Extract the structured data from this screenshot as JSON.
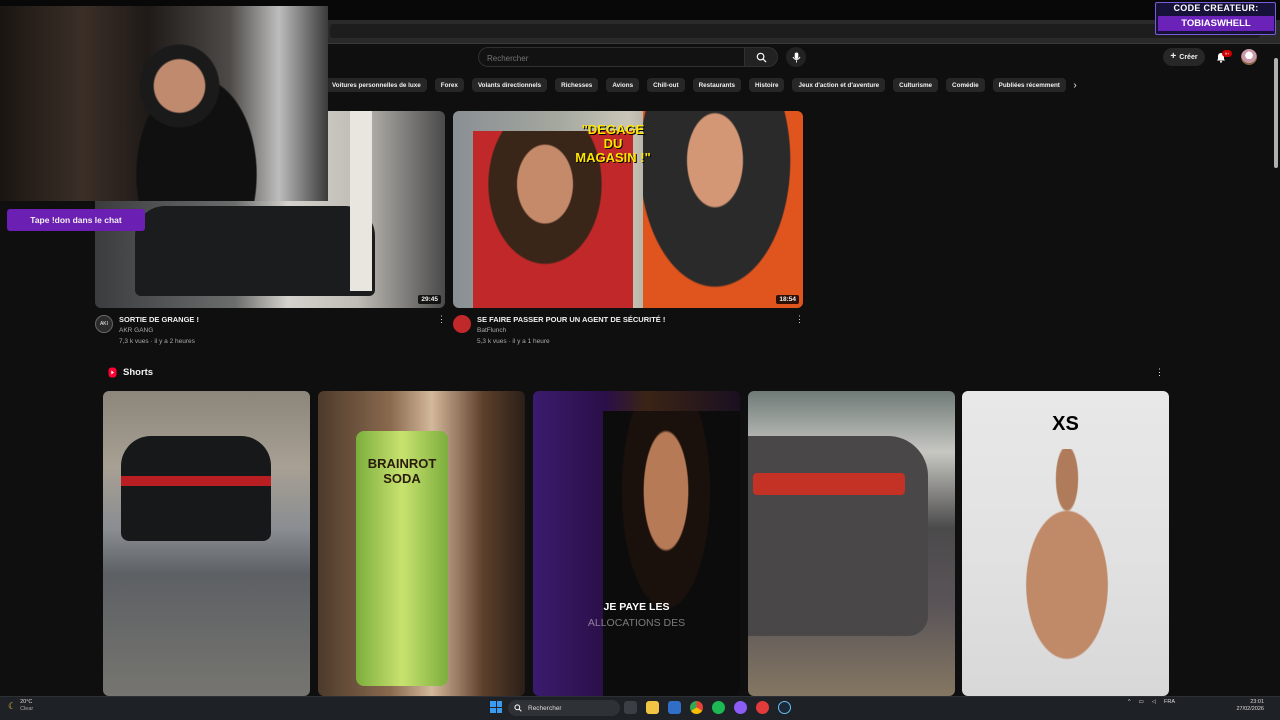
{
  "search": {
    "placeholder": "Rechercher"
  },
  "header": {
    "create_label": "Créer",
    "notif_badge": "9+"
  },
  "chips": [
    "Voitures personnelles de luxe",
    "Forex",
    "Volants directionnels",
    "Richesses",
    "Avions",
    "Chill-out",
    "Restaurants",
    "Histoire",
    "Jeux d'action et d'aventure",
    "Culturisme",
    "Comédie",
    "Publiées récemment"
  ],
  "videos": [
    {
      "title": "SORTIE DE GRANGE !",
      "channel": "AKR GANG",
      "meta": "7,3 k vues · il y a 2 heures",
      "duration": "29:45"
    },
    {
      "title": "SE FAIRE PASSER POUR UN AGENT DE SÉCURITÉ !",
      "channel": "BatFlunch",
      "meta": "5,3 k vues · il y a 1 heure",
      "duration": "18:54",
      "overlay": "\"DEGAGE DU MAGASIN !\""
    }
  ],
  "shorts": {
    "label": "Shorts",
    "items": [
      {
        "overlay": ""
      },
      {
        "overlay": "BRAINROT SODA"
      },
      {
        "overlay": "JE PAYE LES",
        "overlay2": "ALLOCATIONS DES"
      },
      {
        "overlay": ""
      },
      {
        "overlay": "XS"
      }
    ]
  },
  "stream": {
    "chat_banner": "Tape !don dans le chat",
    "creator_line1": "CODE CREATEUR:",
    "creator_line2": "TOBIASWHELL"
  },
  "taskbar": {
    "search_label": "Rechercher",
    "weather_temp": "20°C",
    "weather_desc": "Clear",
    "lang": "FRA",
    "time": "23:01",
    "date": "27/02/2026"
  },
  "colors": {
    "accent": "#ff0000",
    "stream_purple": "#6b1fb3"
  }
}
